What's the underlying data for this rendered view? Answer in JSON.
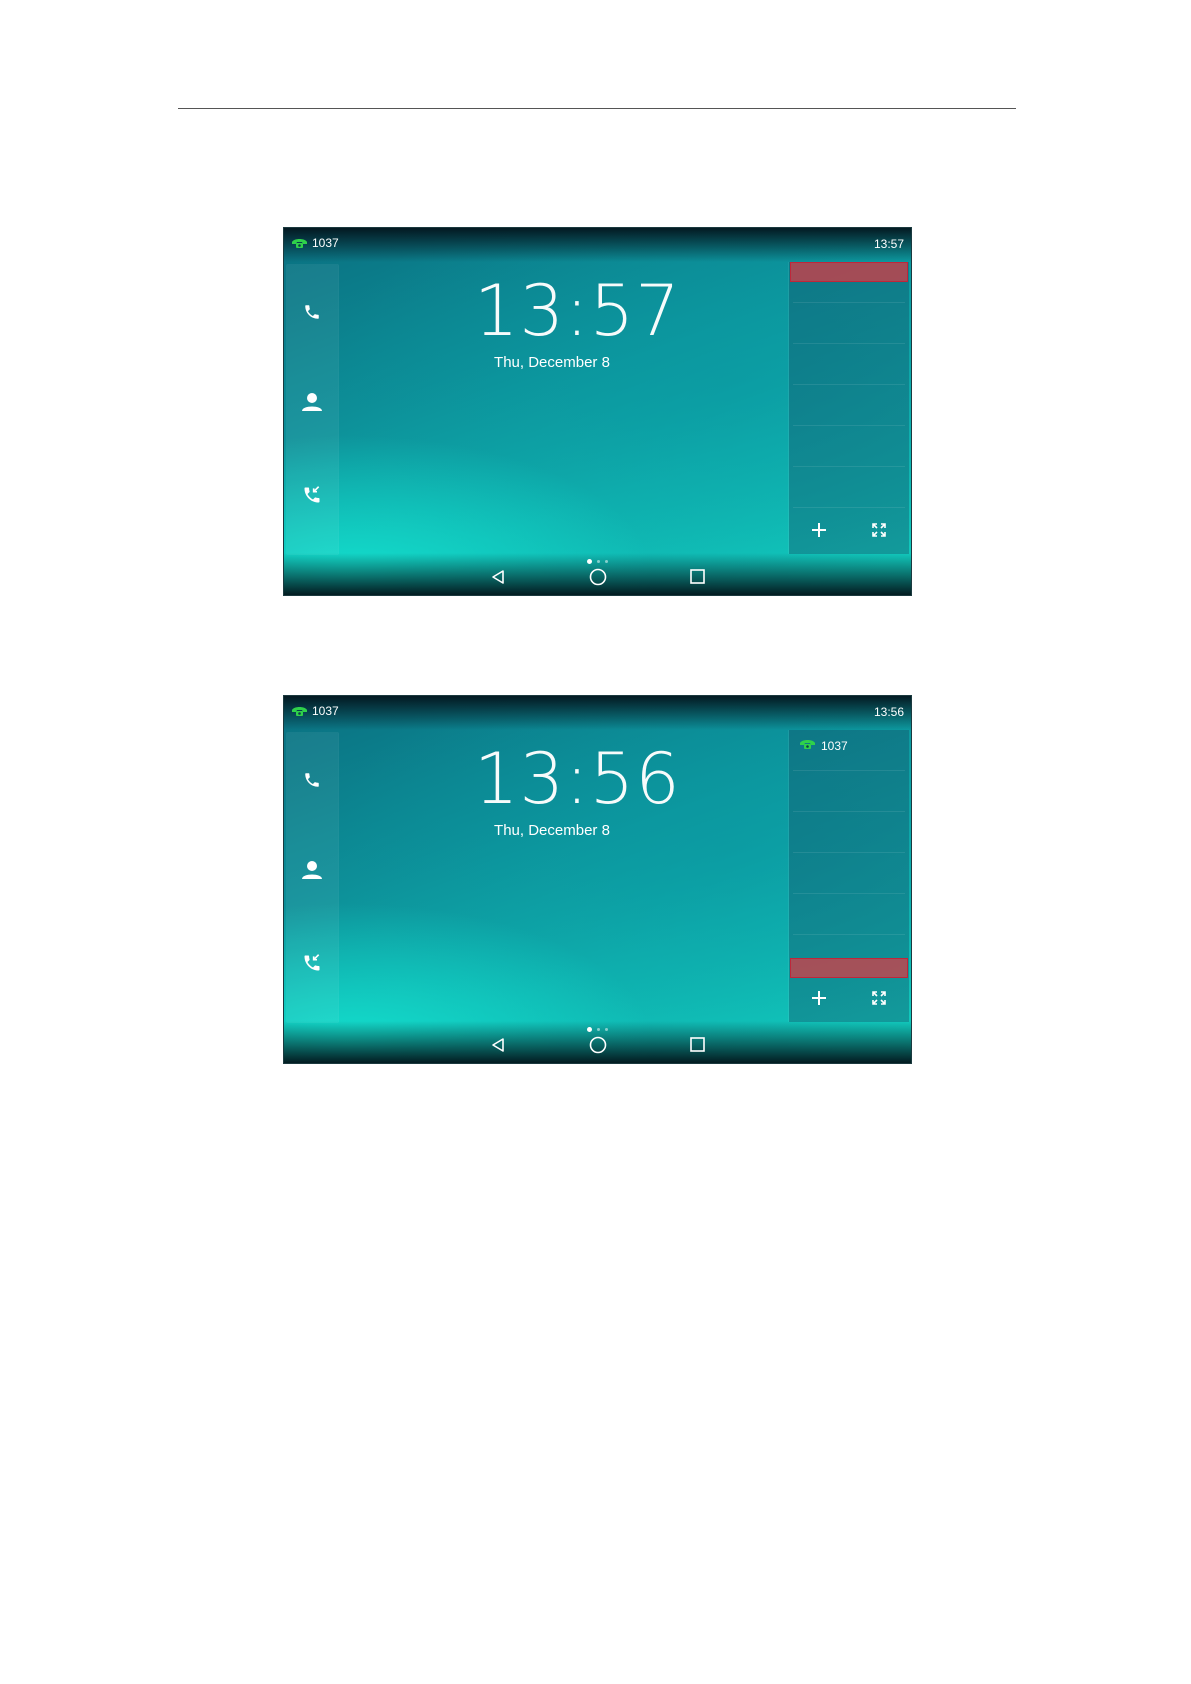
{
  "screens": [
    {
      "status": {
        "account": "1037",
        "time": "13:57"
      },
      "home": {
        "clock": "13:57",
        "date": "Thu, December 8"
      },
      "panel": {
        "account": "",
        "highlight": "top"
      }
    },
    {
      "status": {
        "account": "1037",
        "time": "13:56"
      },
      "home": {
        "clock": "13:56",
        "date": "Thu, December 8"
      },
      "panel": {
        "account": "1037",
        "highlight": "bottom"
      }
    }
  ],
  "colors": {
    "line_registered": "#2fd14a",
    "highlight": "#c0263a"
  },
  "icons": {
    "status_line": "phone-receiver-icon",
    "sidebar": [
      "handset-icon",
      "contact-icon",
      "call-history-icon"
    ],
    "panel_footer": [
      "plus-icon",
      "expand-icon"
    ],
    "navbar": [
      "back-icon",
      "home-icon",
      "recent-apps-icon"
    ]
  }
}
